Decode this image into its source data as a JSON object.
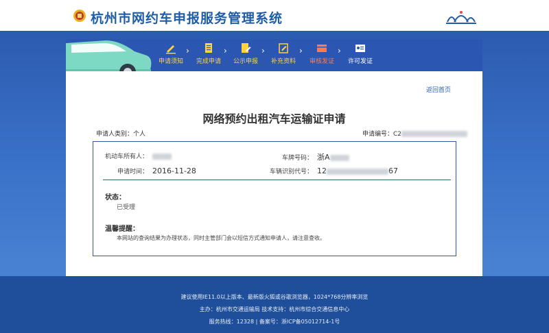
{
  "header": {
    "title": "杭州市网约车申报服务管理系统"
  },
  "progress": {
    "steps": [
      {
        "label": "申请须知",
        "icon": "pencil-icon",
        "state": "done"
      },
      {
        "label": "完成申请",
        "icon": "document-icon",
        "state": "done"
      },
      {
        "label": "公示申报",
        "icon": "edit-document-icon",
        "state": "done"
      },
      {
        "label": "补充资料",
        "icon": "form-edit-icon",
        "state": "done"
      },
      {
        "label": "审核发证",
        "icon": "card-icon",
        "state": "current"
      },
      {
        "label": "许可发证",
        "icon": "certificate-icon",
        "state": "pending"
      }
    ]
  },
  "panel": {
    "back_link": "返回首页",
    "form_title": "网络预约出租汽车运输证申请",
    "applicant_type_label": "申请人类别：",
    "applicant_type_value": "个人",
    "application_no_label": "申请编号：",
    "application_no_value": "C2"
  },
  "details": {
    "vehicle_owner_label": "机动车所有人：",
    "plate_label": "车牌号码：",
    "plate_value": "浙A",
    "apply_date_label": "申请时间：",
    "apply_date_value": "2016-11-28",
    "vin_label": "车辆识别代号：",
    "vin_prefix": "12",
    "vin_suffix": "67"
  },
  "status": {
    "title": "状态：",
    "value": "已受理"
  },
  "notice": {
    "title": "温馨提醒：",
    "text": "本网站的查询结果为办理状态，同时主管部门会以短信方式通知申请人，请注意查收。"
  },
  "footer": {
    "line1": "建议使用IE11.0以上版本、最新版火狐或谷歌浏览器，1024*768分辨率浏览",
    "line2": "主办：杭州市交通运输局  技术支持：杭州市综合交通信息中心",
    "line3": "服务热线：12328 | 备案号：浙ICP备05012714-1号"
  },
  "colors": {
    "accent": "#2f63b6",
    "step_done": "#ffd43b",
    "step_current": "#ff7b54",
    "panel_border": "#2c5aa0"
  }
}
